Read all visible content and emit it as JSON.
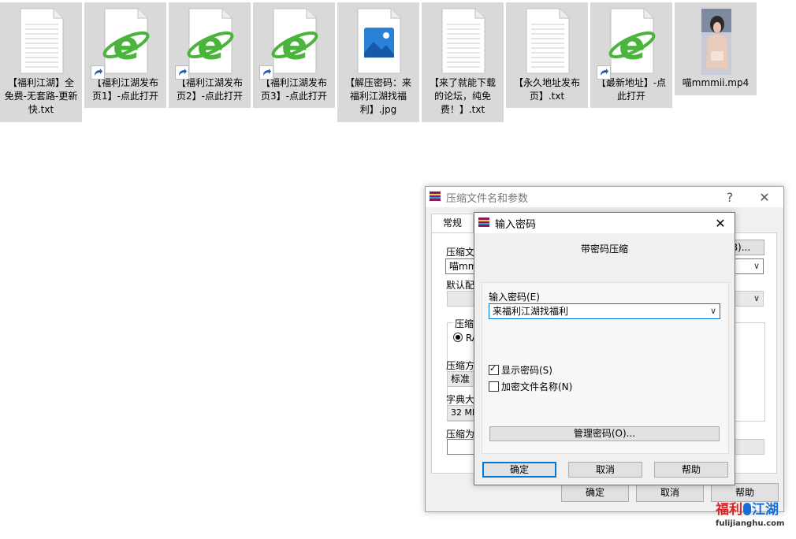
{
  "desktop": {
    "files": [
      {
        "label": "【福利江湖】全免费-无套路-更新快.txt",
        "type": "txt",
        "shortcut": false
      },
      {
        "label": "【福利江湖发布页1】-点此打开",
        "type": "ie",
        "shortcut": true
      },
      {
        "label": "【福利江湖发布页2】-点此打开",
        "type": "ie",
        "shortcut": true
      },
      {
        "label": "【福利江湖发布页3】-点此打开",
        "type": "ie",
        "shortcut": true
      },
      {
        "label": "【解压密码：来福利江湖找福利】.jpg",
        "type": "image",
        "shortcut": false
      },
      {
        "label": "【来了就能下载的论坛，纯免费！】.txt",
        "type": "txt",
        "shortcut": false
      },
      {
        "label": "【永久地址发布页】.txt",
        "type": "txt",
        "shortcut": false
      },
      {
        "label": "【最新地址】-点此打开",
        "type": "ie",
        "shortcut": true
      },
      {
        "label": "喵mmmii.mp4",
        "type": "video",
        "shortcut": false
      }
    ]
  },
  "archive_dialog": {
    "title": "压缩文件名和参数",
    "help_glyph": "?",
    "close_glyph": "✕",
    "tab_general": "常规",
    "label_archive_name": "压缩文",
    "archive_name_value": "喵mmmi",
    "browse_button": "B)...",
    "label_default_profile": "默认配",
    "label_format": "压缩",
    "format_rar": "RA",
    "label_method": "压缩方",
    "method_value": "标准",
    "label_dict": "字典大",
    "dict_value": "32 MB",
    "label_split": "压缩为",
    "ok": "确定",
    "cancel": "取消",
    "help": "帮助"
  },
  "password_dialog": {
    "title": "输入密码",
    "close_glyph": "✕",
    "heading": "带密码压缩",
    "label_password": "输入密码(E)",
    "password_value": "来福利江湖找福利",
    "show_password": "显示密码(S)",
    "show_password_checked": true,
    "encrypt_names": "加密文件名称(N)",
    "encrypt_names_checked": false,
    "manage_button": "管理密码(O)...",
    "ok": "确定",
    "cancel": "取消",
    "help": "帮助"
  },
  "watermark": {
    "text_cn_left": "福利",
    "text_cn_right": "江湖",
    "text_url": "fulijianghu.com"
  },
  "colors": {
    "ie_green": "#4ab43c",
    "focus_blue": "#0078d7",
    "watermark_red": "#e02020",
    "watermark_blue": "#1a6fd6"
  }
}
